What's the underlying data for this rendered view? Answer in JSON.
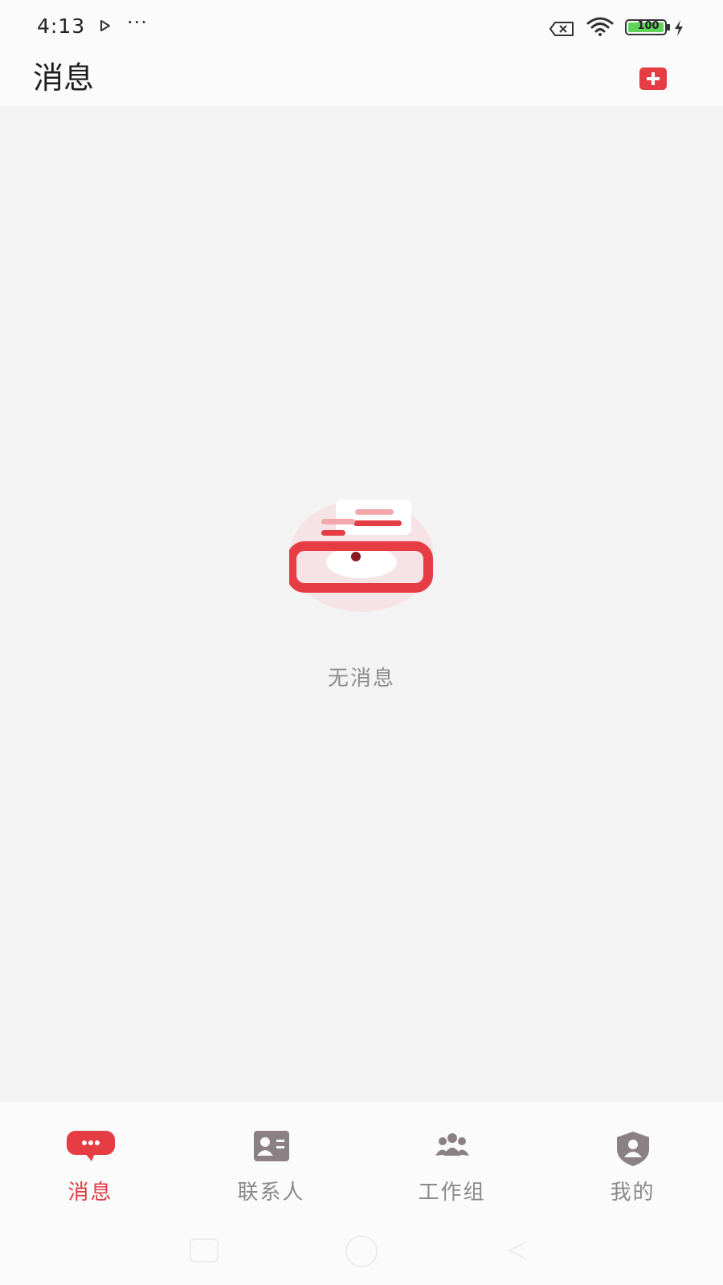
{
  "status_bar": {
    "time": "4:13",
    "more": "···",
    "battery": "100",
    "icons": [
      "play-icon",
      "no-sim-icon",
      "wifi-icon",
      "battery-icon",
      "charging-icon"
    ]
  },
  "header": {
    "title": "消息",
    "add_icon": "add-icon"
  },
  "main": {
    "empty_text": "无消息",
    "empty_icon": "empty-inbox-illustration"
  },
  "tabs": [
    {
      "label": "消息",
      "icon": "message-bubble-icon",
      "active": true
    },
    {
      "label": "联系人",
      "icon": "contact-card-icon",
      "active": false
    },
    {
      "label": "工作组",
      "icon": "group-icon",
      "active": false
    },
    {
      "label": "我的",
      "icon": "profile-shield-icon",
      "active": false
    }
  ],
  "colors": {
    "accent": "#e63c44",
    "inactive": "#8a8a8a",
    "background": "#f4f3f4",
    "bar": "#fbfbfb"
  }
}
